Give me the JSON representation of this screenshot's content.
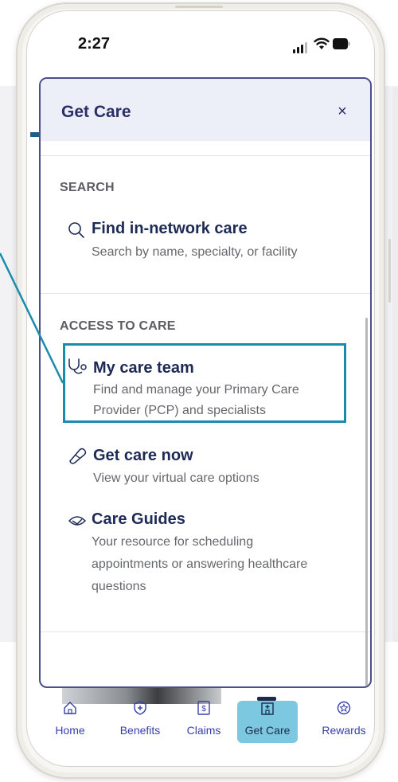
{
  "status_bar": {
    "time": "2:27"
  },
  "sheet": {
    "title": "Get Care",
    "close_symbol": "×",
    "sections": [
      {
        "label": "SEARCH",
        "items": [
          {
            "title": "Find in-network care",
            "description": "Search by name, specialty, or facility",
            "icon": "search-icon"
          }
        ]
      },
      {
        "label": "ACCESS TO CARE",
        "items": [
          {
            "title": "My care team",
            "description_lines": [
              "Find and manage your Primary Care",
              "Provider (PCP) and specialists"
            ],
            "icon": "stethoscope-icon"
          },
          {
            "title": "Get care now",
            "description": "View your virtual care options",
            "icon": "bandage-icon"
          },
          {
            "title": "Care Guides",
            "description_lines": [
              "Your resource for scheduling",
              "appointments or answering healthcare",
              "questions"
            ],
            "icon": "care-guide-icon"
          }
        ]
      }
    ]
  },
  "bottom_nav": [
    {
      "label": "Home",
      "icon": "home-icon"
    },
    {
      "label": "Benefits",
      "icon": "shield-plus-icon"
    },
    {
      "label": "Claims",
      "icon": "dollar-doc-icon"
    },
    {
      "label": "Get Care",
      "icon": "hospital-icon",
      "active": true
    },
    {
      "label": "Rewards",
      "icon": "star-badge-icon"
    }
  ],
  "colors": {
    "accent": "#2b2f66",
    "highlight": "#1a8cab",
    "nav_active": "#7cc8e0"
  }
}
